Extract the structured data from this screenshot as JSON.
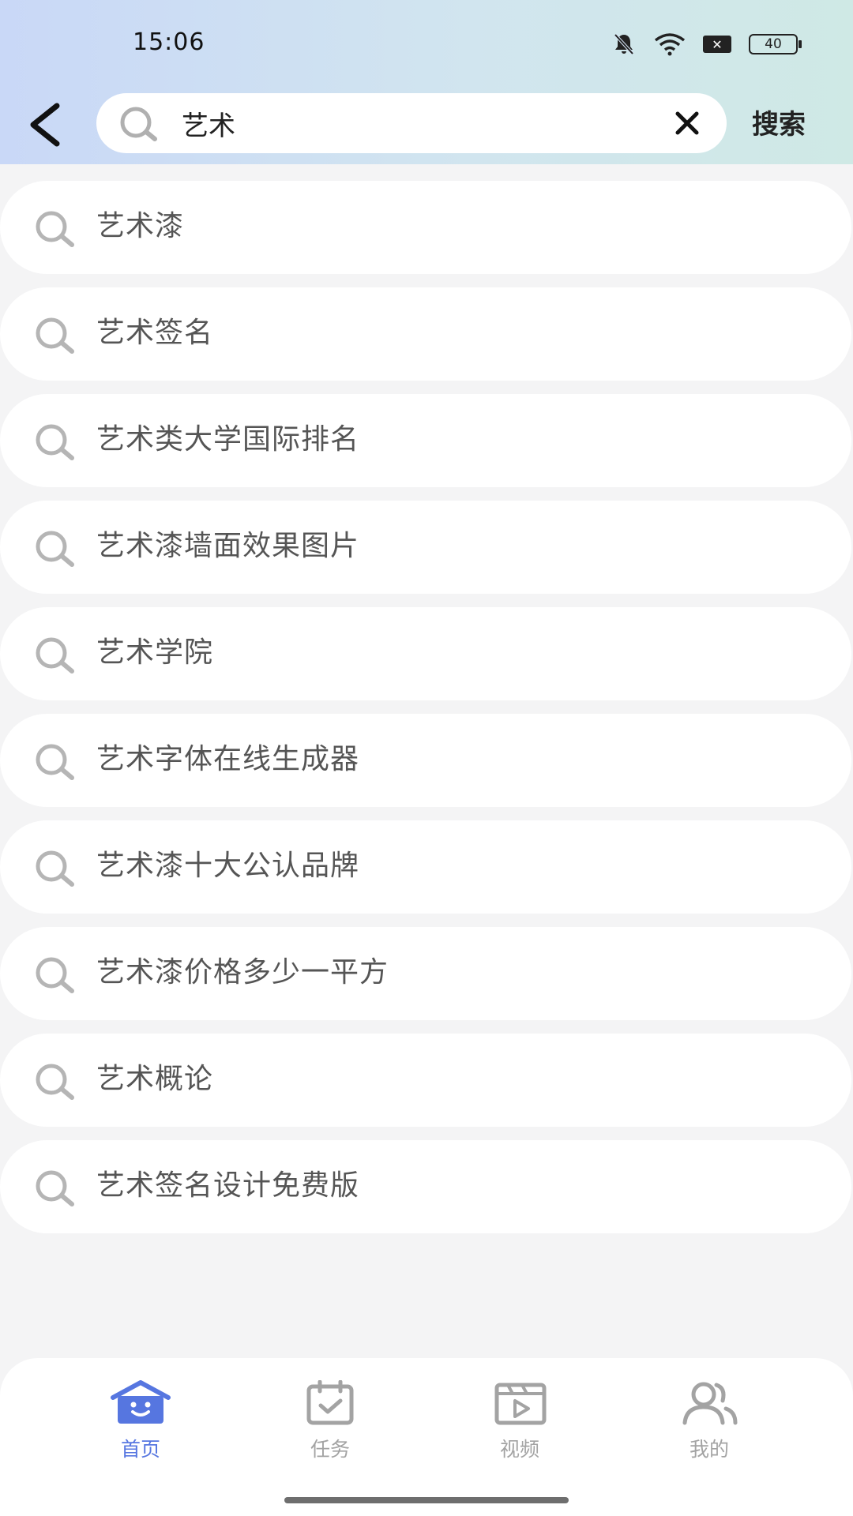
{
  "status_bar": {
    "time": "15:06",
    "battery": "40",
    "icons": [
      "bell-off-icon",
      "wifi-icon",
      "sim-off-icon",
      "battery-icon"
    ]
  },
  "search": {
    "value": "艺术",
    "search_label": "搜索"
  },
  "suggestions": [
    "艺术漆",
    "艺术签名",
    "艺术类大学国际排名",
    "艺术漆墙面效果图片",
    "艺术学院",
    "艺术字体在线生成器",
    "艺术漆十大公认品牌",
    "艺术漆价格多少一平方",
    "艺术概论",
    "艺术签名设计免费版"
  ],
  "tabbar": {
    "tabs": [
      {
        "label": "首页",
        "icon": "home-icon",
        "active": true
      },
      {
        "label": "任务",
        "icon": "calendar-check-icon",
        "active": false
      },
      {
        "label": "视频",
        "icon": "video-icon",
        "active": false
      },
      {
        "label": "我的",
        "icon": "users-icon",
        "active": false
      }
    ]
  },
  "colors": {
    "accent": "#5676e0",
    "inactive": "#a3a3a3",
    "background": "#f4f4f5"
  }
}
